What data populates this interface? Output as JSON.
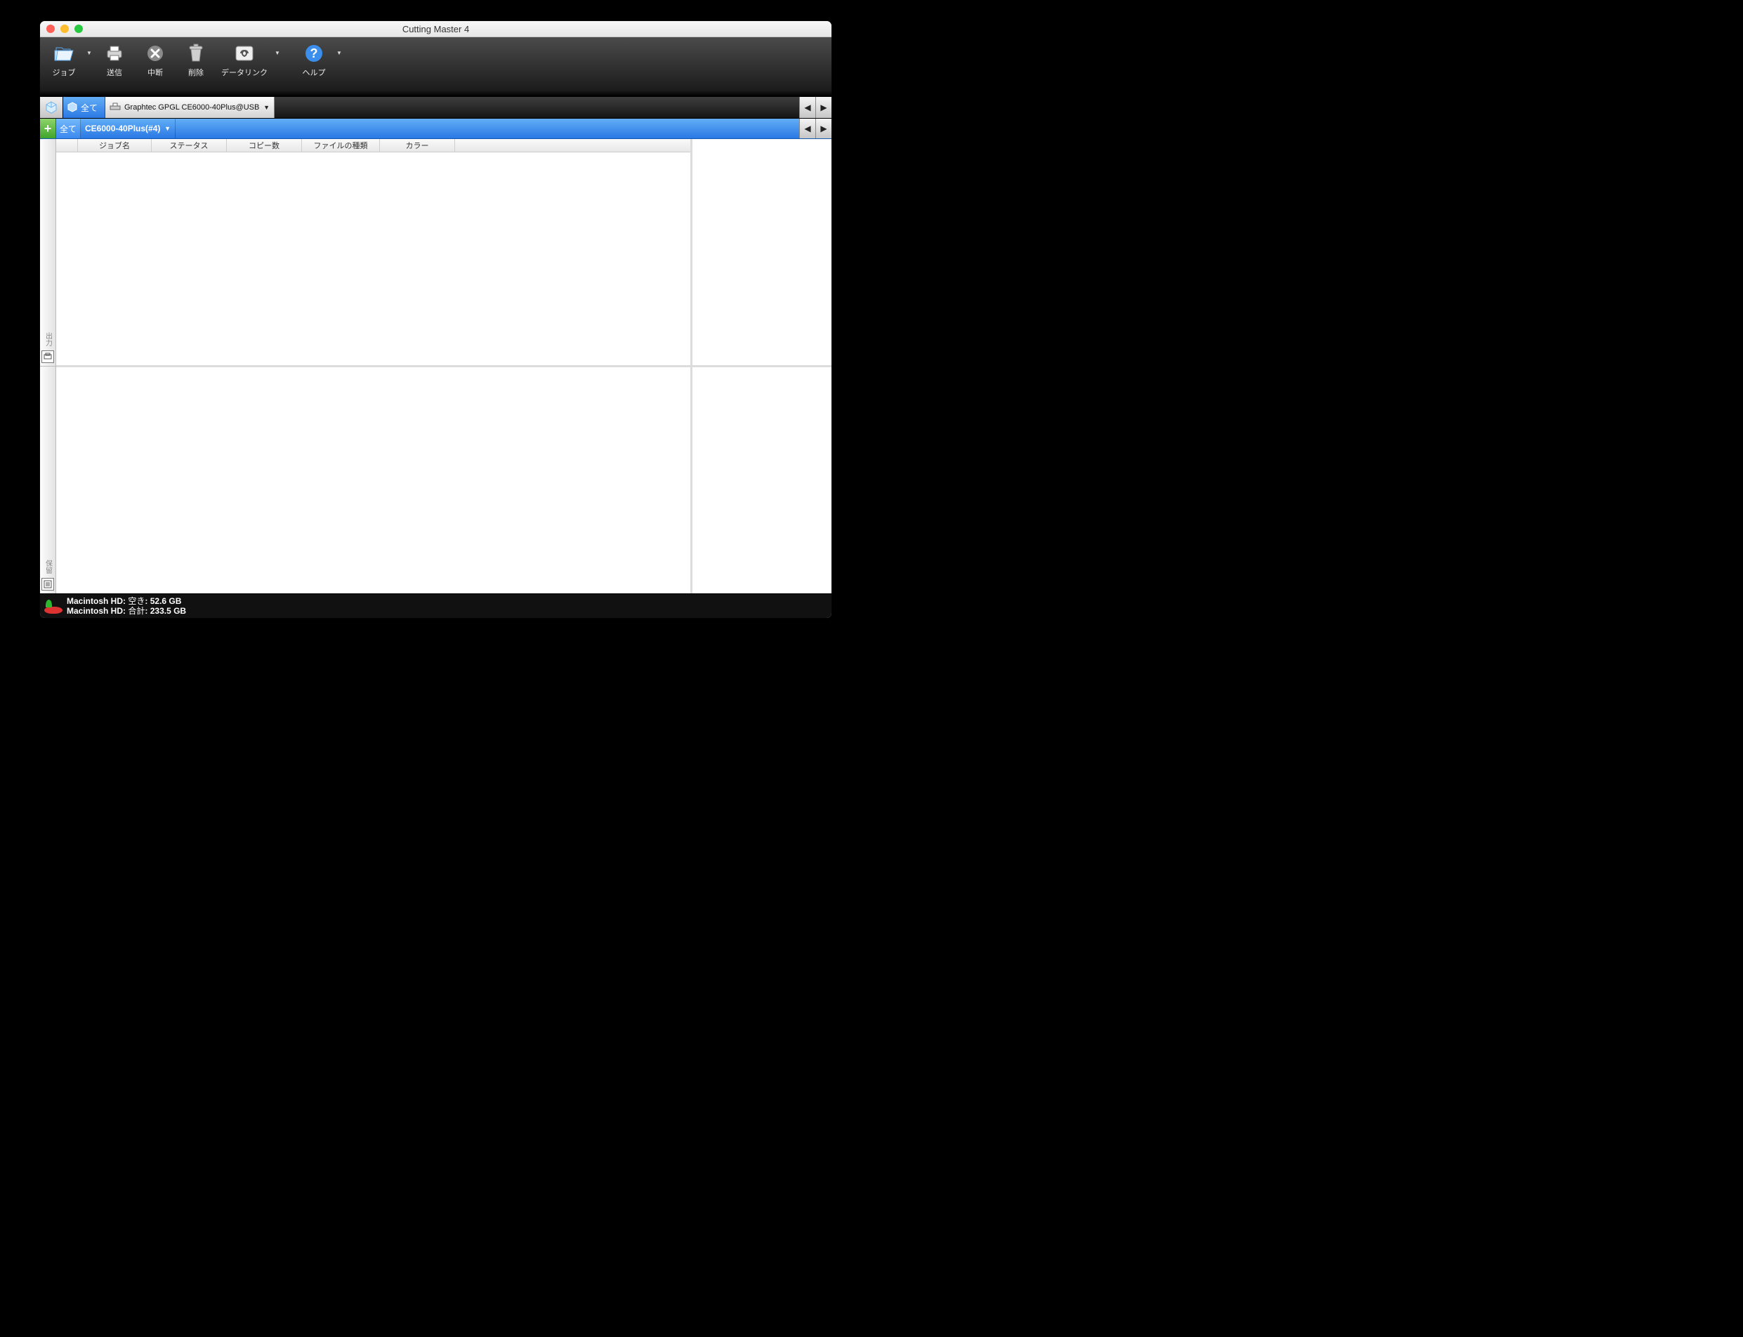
{
  "window": {
    "title": "Cutting Master 4"
  },
  "toolbar": {
    "job": "ジョブ",
    "send": "送信",
    "abort": "中断",
    "delete": "削除",
    "datalink": "データリンク",
    "help": "ヘルプ"
  },
  "devices": {
    "all_label": "全て",
    "selected": "Graphtec GPGL CE6000-40Plus@USB"
  },
  "queues": {
    "all_label": "全て",
    "selected": "CE6000-40Plus(#4)"
  },
  "columns": {
    "job_name": "ジョブ名",
    "status": "ステータス",
    "copies": "コピー数",
    "file_type": "ファイルの種類",
    "color": "カラー"
  },
  "side": {
    "output": "出力",
    "hold": "保留"
  },
  "status": {
    "disk_name": "Macintosh HD",
    "free_label": "空き",
    "free_value": "52.6 GB",
    "total_label": "合計",
    "total_value": "233.5 GB"
  }
}
